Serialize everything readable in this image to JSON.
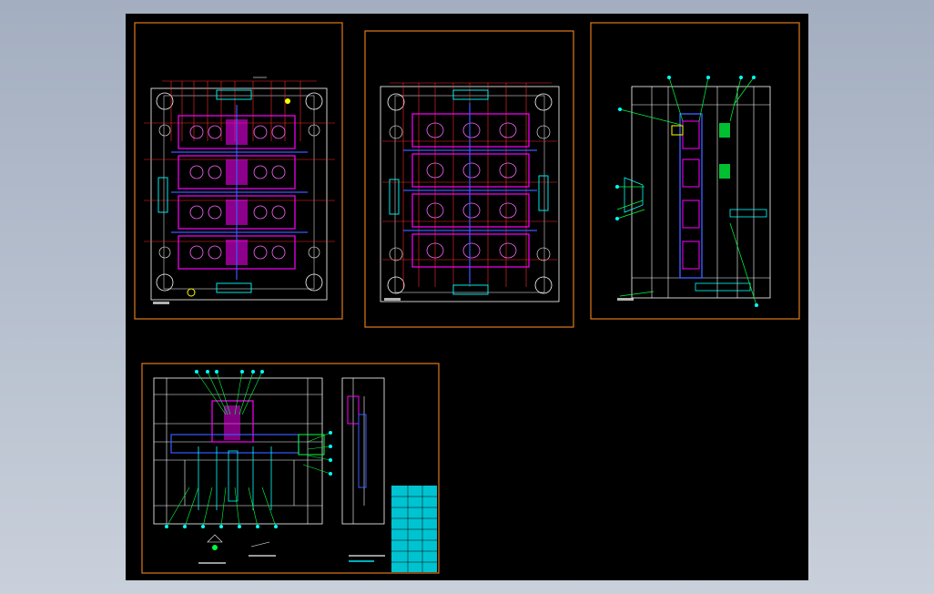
{
  "viewport": {
    "background": "#000000"
  },
  "colors": {
    "border": "#e07a1a",
    "plate": "#ffffff",
    "cavity": "#ff00ff",
    "dimension": "#ff2a2a",
    "centerline": "#3a5bff",
    "annotation": "#00ffff",
    "leader": "#00ff40",
    "highlight": "#ffff00",
    "titleblock": "#00d8e8"
  },
  "sheets": [
    {
      "id": "sheet-1",
      "kind": "plan-view-core"
    },
    {
      "id": "sheet-2",
      "kind": "plan-view-cavity"
    },
    {
      "id": "sheet-3",
      "kind": "side-section"
    },
    {
      "id": "sheet-4",
      "kind": "assembly-section"
    }
  ],
  "icons": [
    "drawing-sheet-icon",
    "title-block-icon"
  ]
}
